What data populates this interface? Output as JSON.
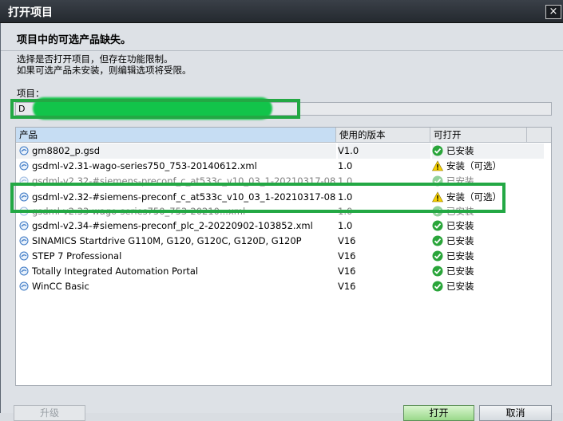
{
  "window": {
    "title": "打开项目",
    "close_label": "×"
  },
  "headline": "项目中的可选产品缺失。",
  "description": [
    "选择是否打开项目，但存在功能限制。",
    "如果可选产品未安装，则编辑选项将受限。"
  ],
  "project": {
    "label": "项目：",
    "path_visible": "D"
  },
  "table": {
    "columns": {
      "product": "产品",
      "version": "使用的版本",
      "open": "可打开"
    },
    "rows": [
      {
        "product": "gm8802_p.gsd",
        "version": "V1.0",
        "status": "已安装",
        "status_icon": "check-icon"
      },
      {
        "product": "gsdml-v2.31-wago-series750_753-20140612.xml",
        "version": "1.0",
        "status": "安装（可选）",
        "status_icon": "warning-icon"
      },
      {
        "product": "gsdml-v2.32-#siemens-preconf_c_at533c_v10_03_1-20210317-081...",
        "version": "1.0",
        "status": "已安装",
        "status_icon": "check-icon"
      },
      {
        "product": "gsdml-v2.32-#siemens-preconf_c_at533c_v10_03_1-20210317-081...",
        "version": "1.0",
        "status": "安装（可选）",
        "status_icon": "warning-icon"
      },
      {
        "product": "gsdml-v2.33-wago-series750_753-20210...xml",
        "version": "1.0",
        "status": "已安装",
        "status_icon": "check-icon"
      },
      {
        "product": "gsdml-v2.34-#siemens-preconf_plc_2-20220902-103852.xml",
        "version": "1.0",
        "status": "已安装",
        "status_icon": "check-icon"
      },
      {
        "product": "SINAMICS Startdrive G110M, G120, G120C, G120D, G120P",
        "version": "V16",
        "status": "已安装",
        "status_icon": "check-icon"
      },
      {
        "product": "STEP 7 Professional",
        "version": "V16",
        "status": "已安装",
        "status_icon": "check-icon"
      },
      {
        "product": "Totally Integrated Automation Portal",
        "version": "V16",
        "status": "已安装",
        "status_icon": "check-icon"
      },
      {
        "product": "WinCC Basic",
        "version": "V16",
        "status": "已安装",
        "status_icon": "check-icon"
      }
    ]
  },
  "buttons": {
    "upgrade": "升级",
    "open": "打开",
    "cancel": "取消"
  },
  "colors": {
    "highlight_green": "#23a844",
    "check_green": "#2aa53a",
    "warning_yellow": "#f5d000"
  }
}
